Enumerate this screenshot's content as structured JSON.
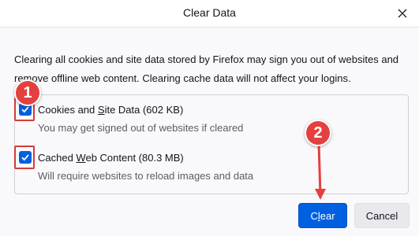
{
  "dialog": {
    "title": "Clear Data",
    "description": "Clearing all cookies and site data stored by Firefox may sign you out of websites and remove offline web content. Clearing cache data will not affect your logins."
  },
  "options": [
    {
      "label_pre": "Cookies and ",
      "label_accel": "S",
      "label_post": "ite Data (602 KB)",
      "sublabel": "You may get signed out of websites if cleared",
      "checked": true
    },
    {
      "label_pre": "Cached ",
      "label_accel": "W",
      "label_post": "eb Content (80.3 MB)",
      "sublabel": "Will require websites to reload images and data",
      "checked": true
    }
  ],
  "buttons": {
    "clear_pre": "C",
    "clear_accel": "l",
    "clear_post": "ear",
    "cancel": "Cancel"
  },
  "annotations": {
    "step1": "1",
    "step2": "2",
    "color": "#e4403f"
  },
  "icons": {
    "close": "close-icon",
    "checkbox": "checkmark-icon"
  },
  "colors": {
    "accent": "#0061e0",
    "background": "#f9f9fb"
  }
}
